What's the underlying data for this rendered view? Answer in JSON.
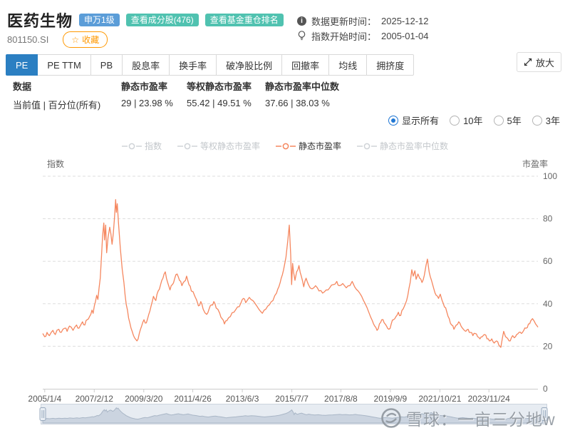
{
  "header": {
    "title": "医药生物",
    "badges": [
      {
        "label": "申万1级",
        "type": "blue"
      },
      {
        "label": "查看成分股(476)",
        "type": "teal"
      },
      {
        "label": "查看基金重仓排名",
        "type": "teal"
      }
    ],
    "code": "801150.SI",
    "favorite": {
      "icon": "☆",
      "label": "收藏"
    },
    "info_lines": [
      {
        "label": "数据更新时间：",
        "value": "2025-12-12"
      },
      {
        "label": "指数开始时间：",
        "value": "2005-01-04"
      }
    ]
  },
  "toolbar": {
    "tabs": [
      {
        "label": "PE",
        "active": true
      },
      {
        "label": "PE TTM",
        "active": false
      },
      {
        "label": "PB",
        "active": false
      },
      {
        "label": "股息率",
        "active": false
      },
      {
        "label": "换手率",
        "active": false
      },
      {
        "label": "破净股比例",
        "active": false
      },
      {
        "label": "回撤率",
        "active": false
      },
      {
        "label": "均线",
        "active": false
      },
      {
        "label": "拥挤度",
        "active": false
      }
    ],
    "zoom_label": "放大"
  },
  "stats": {
    "columns": [
      {
        "header": "数据",
        "value": "当前值 | 百分位(所有)"
      },
      {
        "header": "静态市盈率",
        "value": "29 | 23.98 %"
      },
      {
        "header": "等权静态市盈率",
        "value": "55.42 | 49.51 %"
      },
      {
        "header": "静态市盈率中位数",
        "value": "37.66 | 38.03 %"
      }
    ]
  },
  "range_options": [
    {
      "label": "显示所有",
      "selected": true
    },
    {
      "label": "10年",
      "selected": false
    },
    {
      "label": "5年",
      "selected": false
    },
    {
      "label": "3年",
      "selected": false
    }
  ],
  "legend": [
    {
      "label": "指数",
      "active": false
    },
    {
      "label": "等权静态市盈率",
      "active": false
    },
    {
      "label": "静态市盈率",
      "active": true
    },
    {
      "label": "静态市盈率中位数",
      "active": false
    }
  ],
  "chart_data": {
    "type": "line",
    "left_axis_label": "指数",
    "right_axis_label": "市盈率",
    "ylim": [
      0,
      100
    ],
    "yticks": [
      0,
      20,
      40,
      60,
      80,
      100
    ],
    "grid": "dashed-horizontal",
    "legend_position": "top-center",
    "x_ticks": [
      "2005/1/4",
      "2007/2/12",
      "2009/3/20",
      "2011/4/26",
      "2013/6/3",
      "2015/7/7",
      "2017/8/8",
      "2019/9/9",
      "2021/10/21",
      "2023/11/24"
    ],
    "x_tick_fracs": [
      0.004,
      0.104,
      0.204,
      0.303,
      0.403,
      0.503,
      0.602,
      0.702,
      0.802,
      0.901
    ],
    "x_range_years": [
      2005.02,
      2025.95
    ],
    "series": [
      {
        "name": "静态市盈率",
        "color": "#f5875f",
        "current_value": 29,
        "x_years": [
          2005.02,
          2005.1,
          2005.2,
          2005.3,
          2005.45,
          2005.55,
          2005.7,
          2005.8,
          2005.95,
          2006.05,
          2006.15,
          2006.3,
          2006.45,
          2006.55,
          2006.7,
          2006.8,
          2006.9,
          2007.0,
          2007.1,
          2007.15,
          2007.25,
          2007.3,
          2007.35,
          2007.45,
          2007.5,
          2007.55,
          2007.6,
          2007.63,
          2007.68,
          2007.72,
          2007.78,
          2007.85,
          2007.9,
          2007.95,
          2008.0,
          2008.05,
          2008.1,
          2008.13,
          2008.17,
          2008.22,
          2008.3,
          2008.38,
          2008.45,
          2008.5,
          2008.6,
          2008.7,
          2008.8,
          2008.9,
          2009.0,
          2009.1,
          2009.2,
          2009.3,
          2009.4,
          2009.5,
          2009.6,
          2009.7,
          2009.8,
          2009.9,
          2010.0,
          2010.1,
          2010.2,
          2010.3,
          2010.4,
          2010.5,
          2010.6,
          2010.7,
          2010.8,
          2010.9,
          2011.0,
          2011.1,
          2011.2,
          2011.3,
          2011.45,
          2011.6,
          2011.7,
          2011.8,
          2011.95,
          2012.05,
          2012.15,
          2012.25,
          2012.35,
          2012.5,
          2012.6,
          2012.7,
          2012.8,
          2012.95,
          2013.1,
          2013.25,
          2013.4,
          2013.5,
          2013.6,
          2013.75,
          2013.9,
          2014.0,
          2014.15,
          2014.3,
          2014.45,
          2014.6,
          2014.75,
          2014.9,
          2015.0,
          2015.1,
          2015.2,
          2015.3,
          2015.38,
          2015.44,
          2015.5,
          2015.54,
          2015.58,
          2015.62,
          2015.68,
          2015.75,
          2015.85,
          2015.95,
          2016.05,
          2016.15,
          2016.25,
          2016.4,
          2016.55,
          2016.7,
          2016.85,
          2017.0,
          2017.15,
          2017.3,
          2017.45,
          2017.55,
          2017.7,
          2017.85,
          2018.0,
          2018.1,
          2018.2,
          2018.35,
          2018.5,
          2018.65,
          2018.8,
          2018.95,
          2019.05,
          2019.15,
          2019.25,
          2019.35,
          2019.45,
          2019.55,
          2019.65,
          2019.75,
          2019.85,
          2019.95,
          2020.05,
          2020.15,
          2020.25,
          2020.35,
          2020.45,
          2020.55,
          2020.62,
          2020.68,
          2020.75,
          2020.8,
          2020.88,
          2020.95,
          2021.05,
          2021.15,
          2021.22,
          2021.28,
          2021.35,
          2021.45,
          2021.55,
          2021.65,
          2021.75,
          2021.82,
          2021.9,
          2022.0,
          2022.1,
          2022.2,
          2022.3,
          2022.4,
          2022.5,
          2022.6,
          2022.7,
          2022.8,
          2022.9,
          2023.0,
          2023.1,
          2023.2,
          2023.3,
          2023.4,
          2023.5,
          2023.6,
          2023.7,
          2023.8,
          2023.9,
          2024.0,
          2024.1,
          2024.2,
          2024.3,
          2024.38,
          2024.45,
          2024.5,
          2024.58,
          2024.68,
          2024.78,
          2024.88,
          2024.95,
          2025.05,
          2025.15,
          2025.25,
          2025.35,
          2025.45,
          2025.55,
          2025.65,
          2025.72,
          2025.78,
          2025.85,
          2025.92,
          2025.95
        ],
        "values": [
          26,
          24.5,
          26.5,
          25,
          27.5,
          25.5,
          28,
          26.5,
          28.5,
          27,
          29.5,
          27.5,
          30,
          28.5,
          31.5,
          30,
          32.5,
          34,
          37,
          35.5,
          41,
          44,
          42,
          52,
          62,
          72,
          78,
          70,
          77,
          64,
          71,
          76,
          73,
          68,
          73,
          80,
          89,
          83,
          87,
          78,
          66,
          56,
          50,
          44,
          37,
          31,
          27,
          24,
          22.5,
          26,
          29.5,
          32.5,
          31,
          35,
          39,
          43.5,
          41.5,
          46,
          49,
          52,
          55,
          50,
          46.5,
          49,
          52,
          54,
          51,
          48.5,
          50.5,
          53,
          49,
          46,
          43.5,
          39,
          41,
          37.5,
          35,
          37.5,
          39.5,
          41,
          38,
          35.5,
          33,
          30.5,
          32,
          34,
          36,
          38.5,
          40.5,
          42.5,
          40.5,
          43,
          41.5,
          40,
          37.5,
          35.5,
          37.5,
          39.5,
          41.5,
          45,
          48,
          52,
          56,
          62,
          70,
          77,
          63,
          49,
          59,
          55,
          51,
          55,
          58,
          53,
          48,
          52,
          49,
          47,
          48.5,
          46,
          45,
          46.5,
          47.5,
          49,
          50.5,
          48.5,
          49.5,
          47.5,
          48.5,
          50.5,
          48,
          46,
          43.5,
          40,
          36,
          32,
          29.5,
          27.5,
          30.5,
          32.5,
          31,
          29.5,
          28,
          30.5,
          32.5,
          34,
          36,
          34.5,
          37.5,
          40,
          44,
          50,
          56,
          53,
          55.5,
          51.5,
          54,
          52,
          50,
          53.5,
          58,
          61,
          55,
          51,
          47,
          44,
          42.5,
          44.5,
          41.5,
          38.5,
          36,
          33,
          30,
          28,
          30,
          31.5,
          29.5,
          28,
          27,
          28,
          26.5,
          25,
          26,
          24.5,
          23.5,
          24.5,
          25.5,
          23.5,
          22.5,
          23.5,
          21.5,
          22.5,
          20.5,
          19.5,
          24,
          27,
          24.5,
          23.5,
          22.5,
          25,
          24,
          25.5,
          26.5,
          26,
          27.5,
          28.5,
          30.5,
          32,
          33,
          32,
          30.5,
          29.5,
          29
        ]
      }
    ]
  },
  "watermark": {
    "text": "雪球：一亩三分地w"
  },
  "colors": {
    "line": "#f5875f",
    "tab_active": "#2b7fc2",
    "badge_blue": "#5b9dd8",
    "badge_teal": "#50c2b0",
    "favorite_orange": "#ff9800",
    "radio_blue": "#2077d4",
    "grid": "#dddddd",
    "navigator_fill": "#cbd4e0",
    "navigator_bg": "#e7ecf2"
  }
}
